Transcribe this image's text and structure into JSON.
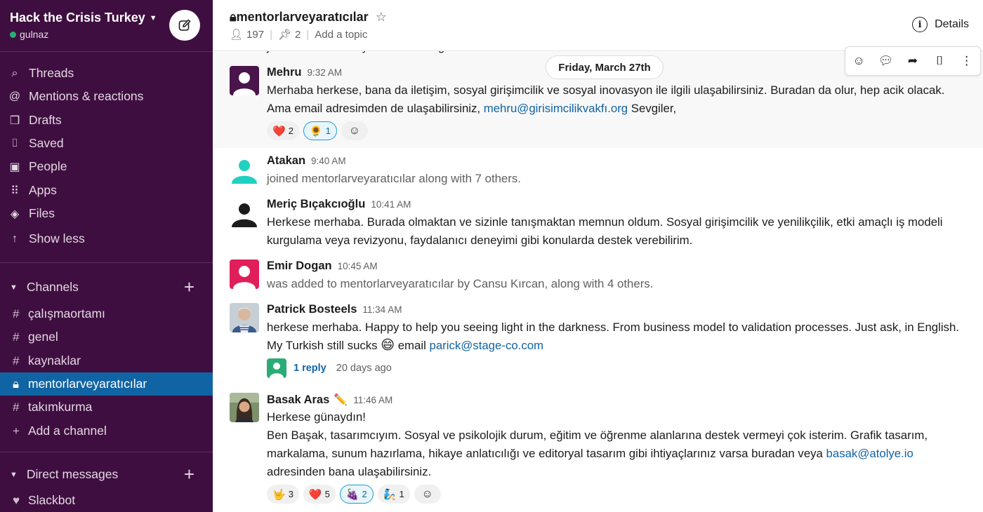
{
  "workspace": {
    "name": "Hack the Crisis Turkey",
    "user": "gulnaz"
  },
  "sidebar": {
    "nav": [
      {
        "label": "Threads",
        "icon": "threads-icon"
      },
      {
        "label": "Mentions & reactions",
        "icon": "at-icon"
      },
      {
        "label": "Drafts",
        "icon": "drafts-icon"
      },
      {
        "label": "Saved",
        "icon": "bookmark-icon"
      },
      {
        "label": "People",
        "icon": "people-icon"
      },
      {
        "label": "Apps",
        "icon": "apps-icon"
      },
      {
        "label": "Files",
        "icon": "files-icon"
      },
      {
        "label": "Show less",
        "icon": "arrow-up-icon"
      }
    ],
    "channels_label": "Channels",
    "channels": [
      "çalışmaortamı",
      "genel",
      "kaynaklar",
      "mentorlarveyaratıcılar",
      "takımkurma"
    ],
    "add_channel": "Add a channel",
    "dm_label": "Direct messages",
    "dms": [
      "Slackbot"
    ]
  },
  "channel": {
    "name": "mentorlarveyaratıcılar",
    "members": "197",
    "pins": "2",
    "topic": "Add a topic",
    "details": "Details"
  },
  "peek_text": "joined mentorlarveyaratıcılar along with 7 others.",
  "date_divider": "Friday, March 27th",
  "messages": [
    {
      "author": "Mehru",
      "time": "9:32 AM",
      "text_1": "Merhaba herkese, bana da iletişim, sosyal girişimcilik ve sosyal inovasyon ile ilgili ulaşabilirsiniz. Buradan da olur, hep acik olacak.",
      "text_2a": "Ama email adresimden de ulaşabilirsiniz, ",
      "email": "mehru@girisimcilikvakfı.org",
      "text_2b": " Sevgiler,",
      "reactions": [
        {
          "emoji": "❤️",
          "count": "2"
        },
        {
          "emoji": "🌻",
          "count": "1"
        }
      ]
    },
    {
      "author": "Atakan",
      "time": "9:40 AM",
      "text": "joined mentorlarveyaratıcılar along with 7 others."
    },
    {
      "author": "Meriç Bıçakcıoğlu",
      "time": "10:41 AM",
      "text_1": "Herkese merhaba. Burada olmaktan ve sizinle tanışmaktan memnun oldum. Sosyal girişimcilik ve yenilikçilik, etki amaçlı iş modeli",
      "text_2": "kurgulama veya revizyonu, faydalanıcı deneyimi gibi konularda destek verebilirim."
    },
    {
      "author": "Emir Dogan",
      "time": "10:45 AM",
      "text": "was added to mentorlarveyaratıcılar by Cansu Kırcan, along with 4 others."
    },
    {
      "author": "Patrick Bosteels",
      "time": "11:34 AM",
      "text_1": "herkese merhaba. Happy to help you seeing light in the darkness. From business model to validation processes. Just ask, in English.",
      "text_2a": "My Turkish still sucks ",
      "text_2b": " email ",
      "email": "parick@stage-co.com",
      "replies": "1 reply",
      "replies_ago": "20 days ago"
    },
    {
      "author": "Basak Aras",
      "time": "11:46 AM",
      "text_1": "Herkese günaydın!",
      "text_2": "Ben Başak, tasarımcıyım. Sosyal ve psikolojik durum, eğitim ve öğrenme alanlarına destek vermeyi çok isterim. Grafik tasarım,",
      "text_3a": "markalama, sunum hazırlama, hikaye anlatıcılığı ve editoryal tasarım gibi ihtiyaçlarınız varsa buradan veya ",
      "email": "basak@atolye.io",
      "text_4": "adresinden bana ulaşabilirsiniz.",
      "reactions": [
        {
          "emoji": "🤟",
          "count": "3"
        },
        {
          "emoji": "❤️",
          "count": "5"
        },
        {
          "emoji": "🍇",
          "count": "2"
        },
        {
          "emoji": "🧞",
          "count": "1"
        }
      ]
    }
  ],
  "colors": {
    "sidebar": "#3f0e40",
    "active": "#1164a3",
    "link": "#1264a3",
    "presence": "#2bac76"
  }
}
